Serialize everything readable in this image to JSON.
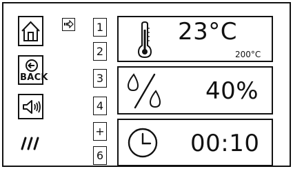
{
  "left_buttons": {
    "back_label": "BACK",
    "home_icon": "home-icon",
    "sound_icon": "speaker-icon",
    "slashes_icon": "triple-slash-icon"
  },
  "indicator": {
    "icon": "arrow-right-icon"
  },
  "number_keys": [
    "1",
    "2",
    "3",
    "4",
    "+",
    "6"
  ],
  "panels": {
    "temperature": {
      "value": "23°C",
      "setpoint": "200°C",
      "icon": "thermometer-icon"
    },
    "humidity": {
      "value": "40%",
      "icon": "humidity-percent-icon"
    },
    "timer": {
      "value": "00:10",
      "icon": "clock-icon"
    }
  }
}
